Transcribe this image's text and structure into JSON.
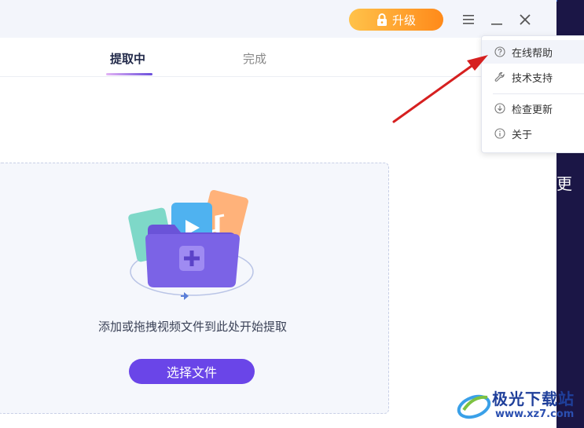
{
  "titlebar": {
    "upgrade_label": "升级"
  },
  "tabs": [
    {
      "label": "提取中",
      "active": true
    },
    {
      "label": "完成",
      "active": false
    }
  ],
  "dropzone": {
    "hint": "添加或拖拽视频文件到此处开始提取",
    "button_label": "选择文件"
  },
  "menu": {
    "items": [
      {
        "label": "在线帮助",
        "icon": "question-circle-icon"
      },
      {
        "label": "技术支持",
        "icon": "wrench-icon"
      },
      {
        "label": "检查更新",
        "icon": "download-circle-icon"
      },
      {
        "label": "关于",
        "icon": "info-circle-icon"
      }
    ]
  },
  "background_window": {
    "partial_text": "更"
  },
  "watermark": {
    "title": "极光下载站",
    "url": "www.xz7.com"
  },
  "colors": {
    "accent": "#6a45e8",
    "upgrade": "#ff9a1f",
    "annotation_arrow": "#d62020"
  }
}
